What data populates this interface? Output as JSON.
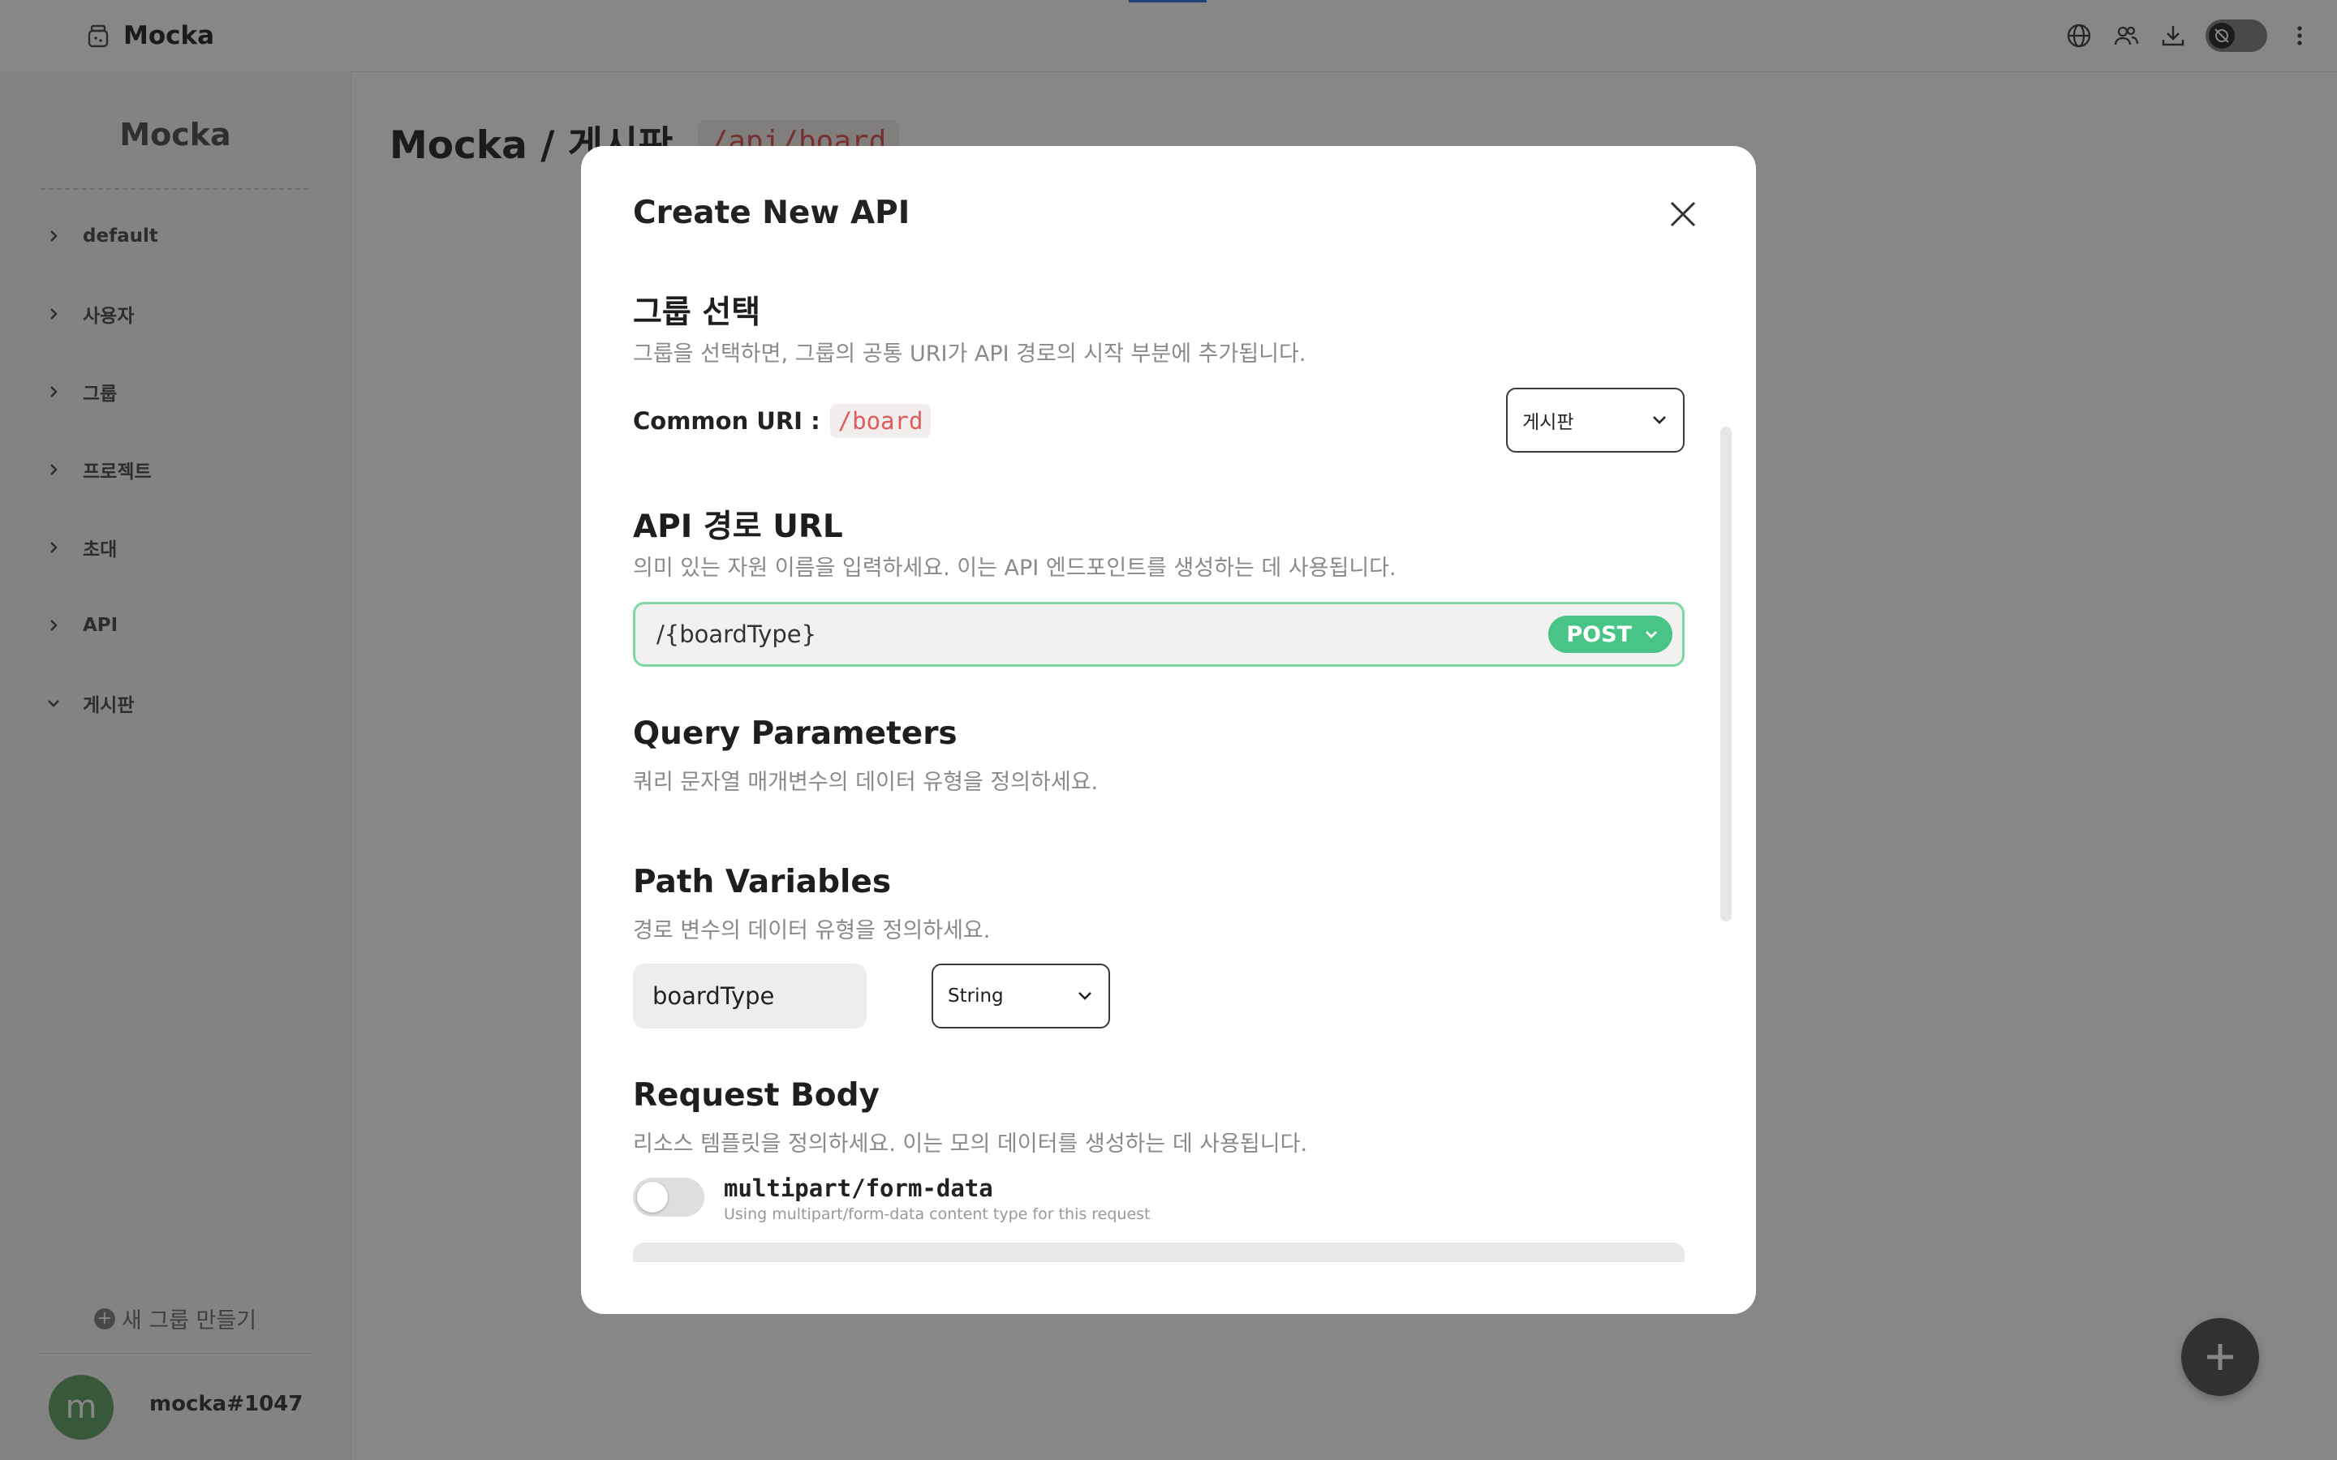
{
  "app": {
    "name": "Mocka",
    "icons": [
      "globe-icon",
      "users-icon",
      "download-icon",
      "theme-toggle",
      "more-vertical-icon"
    ]
  },
  "sidebar": {
    "title": "Mocka",
    "items": [
      {
        "label": "default",
        "expanded": false
      },
      {
        "label": "사용자",
        "expanded": false
      },
      {
        "label": "그룹",
        "expanded": false
      },
      {
        "label": "프로젝트",
        "expanded": false
      },
      {
        "label": "초대",
        "expanded": false
      },
      {
        "label": "API",
        "expanded": false
      },
      {
        "label": "게시판",
        "expanded": true
      }
    ],
    "new_group_label": "새 그룹 만들기",
    "user": {
      "avatar_letter": "m",
      "name": "mocka#1047"
    }
  },
  "main": {
    "title": "Mocka / 게시판",
    "path": "/api/board"
  },
  "modal": {
    "title": "Create New API",
    "group_section": {
      "title": "그룹 선택",
      "description": "그룹을 선택하면, 그룹의 공통 URI가 API 경로의 시작 부분에 추가됩니다.",
      "common_uri_label": "Common URI :",
      "common_uri_value": "/board",
      "selected_group": "게시판"
    },
    "url_section": {
      "title": "API 경로 URL",
      "description": "의미 있는 자원 이름을 입력하세요. 이는 API 엔드포인트를 생성하는 데 사용됩니다.",
      "value": "/{boardType}",
      "method": "POST"
    },
    "query_section": {
      "title": "Query Parameters",
      "description": "쿼리 문자열 매개변수의 데이터 유형을 정의하세요."
    },
    "path_section": {
      "title": "Path Variables",
      "description": "경로 변수의 데이터 유형을 정의하세요.",
      "variable_name": "boardType",
      "variable_type": "String"
    },
    "body_section": {
      "title": "Request Body",
      "description": "리소스 템플릿을 정의하세요. 이는 모의 데이터를 생성하는 데 사용됩니다.",
      "multipart_label": "multipart/form-data",
      "multipart_help": "Using multipart/form-data content type for this request",
      "multipart_enabled": false
    }
  },
  "colors": {
    "accent_green": "#48c586",
    "code_red": "#e05a5a",
    "avatar_green": "#6aa86d"
  }
}
